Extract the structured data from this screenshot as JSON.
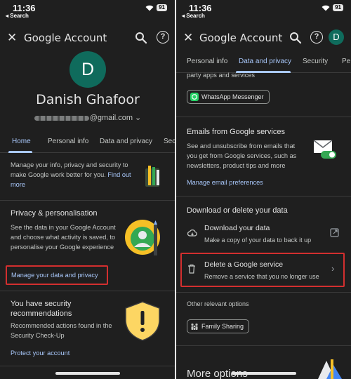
{
  "status": {
    "time": "11:36",
    "back_label": "◂ Search",
    "battery": "91"
  },
  "left": {
    "header": {
      "title": "Google Account"
    },
    "profile": {
      "initial": "D",
      "name": "Danish Ghafoor",
      "email_suffix": "@gmail.com"
    },
    "tabs": [
      "Home",
      "Personal info",
      "Data and privacy",
      "Secu"
    ],
    "intro": {
      "text": "Manage your info, privacy and security to make Google work better for you.",
      "link": "Find out more"
    },
    "privacy": {
      "title": "Privacy & personalisation",
      "description": "See the data in your Google Account and choose what activity is saved, to personalise your Google experience",
      "link": "Manage your data and privacy"
    },
    "security": {
      "title": "You have security recommendations",
      "description": "Recommended actions found in the Security Check-Up",
      "link": "Protect your account"
    }
  },
  "right": {
    "header": {
      "title": "Google Account",
      "avatar_initial": "D"
    },
    "tabs": [
      "Personal info",
      "Data and privacy",
      "Security",
      "Pe"
    ],
    "partial_text": "party apps and services",
    "whatsapp_chip": "WhatsApp Messenger",
    "emails": {
      "title": "Emails from Google services",
      "description": "See and unsubscribe from emails that you get from Google services, such as newsletters, product tips and more",
      "link": "Manage email preferences"
    },
    "download_delete": {
      "title": "Download or delete your data",
      "download": {
        "title": "Download your data",
        "subtitle": "Make a copy of your data to back it up"
      },
      "delete": {
        "title": "Delete a Google service",
        "subtitle": "Remove a service that you no longer use"
      }
    },
    "other": {
      "label": "Other relevant options",
      "chip": "Family Sharing"
    },
    "more_options": "More options"
  },
  "colors": {
    "background": "#1f1f1f",
    "accent_link": "#a8c7fa",
    "highlight_box": "#d32f2f",
    "avatar": "#0f6b5c"
  },
  "icons": [
    "close-icon",
    "search-icon",
    "help-icon",
    "wifi-icon",
    "signal-icon",
    "download-cloud-icon",
    "trash-icon",
    "external-link-icon",
    "chevron-right-icon",
    "whatsapp-icon",
    "family-icon"
  ]
}
